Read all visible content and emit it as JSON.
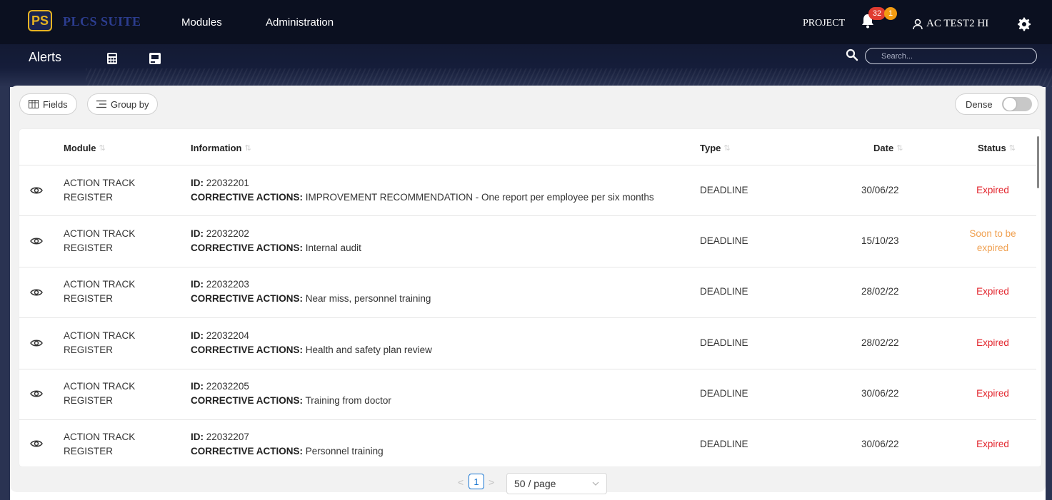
{
  "app": {
    "logo_mark": "PS",
    "logo_text": "PLCS SUITE"
  },
  "nav": {
    "items": [
      {
        "label": "Modules"
      },
      {
        "label": "Administration"
      }
    ],
    "project_label": "PROJECT",
    "notification_badges": [
      "32",
      "1"
    ],
    "user_name": "AC TEST2 HI"
  },
  "toolbar": {
    "title": "Alerts",
    "search_placeholder": "Search..."
  },
  "controls": {
    "fields_label": "Fields",
    "group_by_label": "Group by",
    "dense_label": "Dense",
    "dense_enabled": false
  },
  "table": {
    "columns": [
      "Module",
      "Information",
      "Type",
      "Date",
      "Status"
    ],
    "id_prefix": "ID:",
    "info_prefix": "CORRECTIVE ACTIONS:",
    "rows": [
      {
        "module": [
          "ACTION TRACK",
          "REGISTER"
        ],
        "id": "22032201",
        "info": "IMPROVEMENT RECOMMENDATION - One report per employee per six months",
        "type": "DEADLINE",
        "date": "30/06/22",
        "status": "Expired",
        "status_kind": "expired"
      },
      {
        "module": [
          "ACTION TRACK",
          "REGISTER"
        ],
        "id": "22032202",
        "info": "Internal audit",
        "type": "DEADLINE",
        "date": "15/10/23",
        "status": "Soon to be expired",
        "status_kind": "soon"
      },
      {
        "module": [
          "ACTION TRACK",
          "REGISTER"
        ],
        "id": "22032203",
        "info": "Near miss, personnel training",
        "type": "DEADLINE",
        "date": "28/02/22",
        "status": "Expired",
        "status_kind": "expired"
      },
      {
        "module": [
          "ACTION TRACK",
          "REGISTER"
        ],
        "id": "22032204",
        "info": "Health and safety plan review",
        "type": "DEADLINE",
        "date": "28/02/22",
        "status": "Expired",
        "status_kind": "expired"
      },
      {
        "module": [
          "ACTION TRACK",
          "REGISTER"
        ],
        "id": "22032205",
        "info": "Training from doctor",
        "type": "DEADLINE",
        "date": "30/06/22",
        "status": "Expired",
        "status_kind": "expired"
      },
      {
        "module": [
          "ACTION TRACK",
          "REGISTER"
        ],
        "id": "22032207",
        "info": "Personnel training",
        "type": "DEADLINE",
        "date": "30/06/22",
        "status": "Expired",
        "status_kind": "expired"
      }
    ]
  },
  "pagination": {
    "current_page": "1",
    "page_size": "50 / page"
  },
  "colors": {
    "expired": "#e2232b",
    "soon": "#f0a050",
    "accent": "#1976d2",
    "header_bg": "#0b1020"
  },
  "icons": [
    "logo-icon",
    "bell-icon",
    "user-icon",
    "gear-icon",
    "calculator-icon",
    "pdf-icon",
    "search-icon",
    "table-icon",
    "list-icon",
    "eye-icon",
    "sort-icon",
    "chevron-left-icon",
    "chevron-right-icon",
    "chevron-down-icon"
  ]
}
